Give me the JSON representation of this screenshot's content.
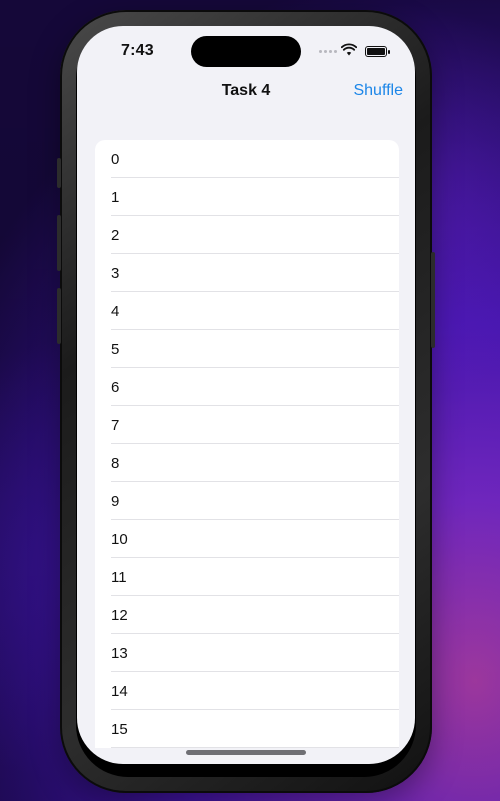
{
  "status_bar": {
    "time": "7:43"
  },
  "nav": {
    "title": "Task 4",
    "shuffle_label": "Shuffle"
  },
  "list": {
    "items": [
      "0",
      "1",
      "2",
      "3",
      "4",
      "5",
      "6",
      "7",
      "8",
      "9",
      "10",
      "11",
      "12",
      "13",
      "14",
      "15"
    ]
  },
  "colors": {
    "accent": "#1c86e8",
    "background": "#f2f2f7",
    "row_background": "#ffffff",
    "separator": "#e2e2e6"
  }
}
